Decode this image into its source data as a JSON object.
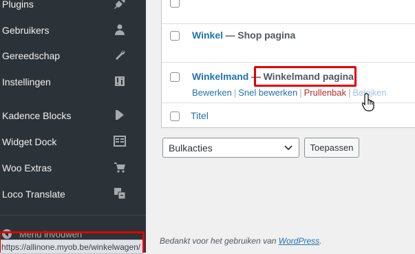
{
  "sidebar": {
    "items": [
      {
        "label": "Plugins",
        "icon": "plugin-icon"
      },
      {
        "label": "Gebruikers",
        "icon": "user-icon"
      },
      {
        "label": "Gereedschap",
        "icon": "wrench-icon"
      },
      {
        "label": "Instellingen",
        "icon": "settings-icon"
      },
      {
        "label": "Kadence Blocks",
        "icon": "kadence-icon"
      },
      {
        "label": "Widget Dock",
        "icon": "widget-icon"
      },
      {
        "label": "Woo Extras",
        "icon": "cart-icon"
      },
      {
        "label": "Loco Translate",
        "icon": "translate-icon"
      }
    ],
    "collapse_label": "Menu invouwen"
  },
  "statusbar": {
    "url": "https://allinone.myob.be/winkelwagen/"
  },
  "table": {
    "rows": [
      {
        "title": "Winkel",
        "dash": "—",
        "state": "Shop pagina"
      },
      {
        "title": "Winkelmand",
        "dash": "—",
        "state": "Winkelmand pagina",
        "actions": {
          "edit": "Bewerken",
          "quick_edit": "Snel bewerken",
          "trash": "Prullenbak",
          "view": "Bekijken"
        }
      }
    ],
    "footer_column": "Titel"
  },
  "bulk": {
    "selected": "Bulkacties",
    "apply_label": "Toepassen"
  },
  "footer": {
    "thanks": "Bedankt voor het gebruiken van",
    "wordpress": "WordPress",
    "period": "."
  },
  "colors": {
    "accent": "#2271b1",
    "highlight": "#e00000",
    "sidebar_bg": "#2c3338"
  }
}
